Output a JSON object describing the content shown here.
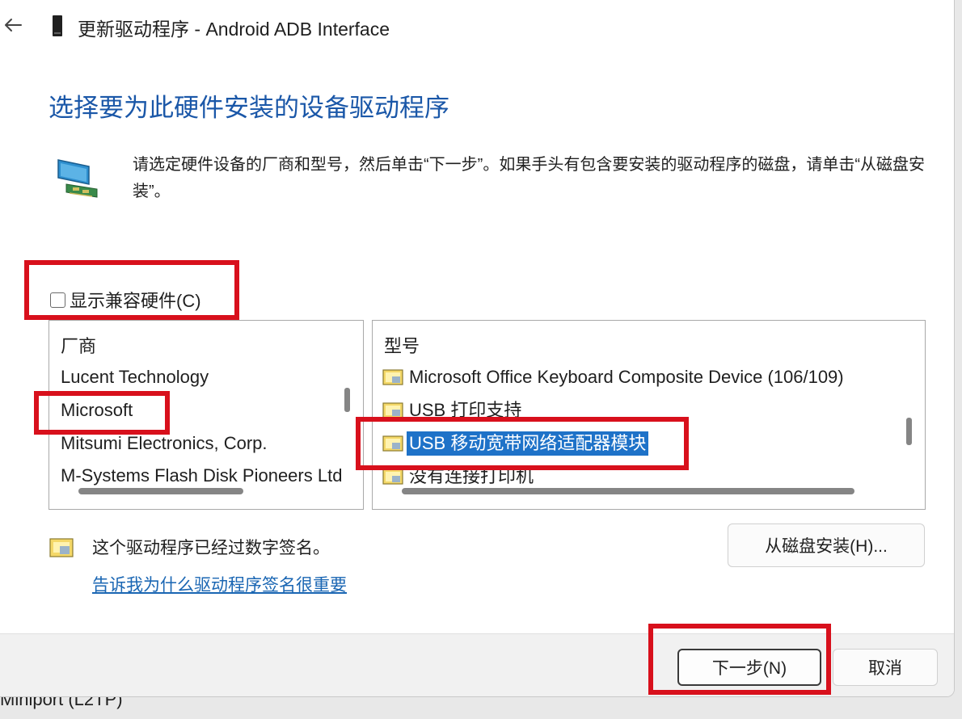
{
  "window": {
    "title": "更新驱动程序 - Android ADB Interface"
  },
  "page": {
    "heading": "选择要为此硬件安装的设备驱动程序",
    "instruction": "请选定硬件设备的厂商和型号，然后单击“下一步”。如果手头有包含要安装的驱动程序的磁盘，请单击“从磁盘安装”。"
  },
  "compatible_checkbox": {
    "label": "显示兼容硬件(C)",
    "checked": false
  },
  "manufacturer_list": {
    "header": "厂商",
    "items": [
      "Lucent Technology",
      "Microsoft",
      "Mitsumi Electronics, Corp.",
      "M-Systems Flash Disk Pioneers Ltd"
    ],
    "selected": "Microsoft"
  },
  "model_list": {
    "header": "型号",
    "items": [
      "Microsoft Office Keyboard Composite Device (106/109)",
      "USB 打印支持",
      "USB 移动宽带网络适配器模块",
      "没有连接打印机"
    ],
    "selected": "USB 移动宽带网络适配器模块"
  },
  "signature": {
    "text": "这个驱动程序已经过数字签名。",
    "link": "告诉我为什么驱动程序签名很重要"
  },
  "buttons": {
    "have_disk": "从磁盘安装(H)...",
    "next": "下一步(N)",
    "cancel": "取消"
  },
  "background": {
    "text": "Miniport (L2TP)"
  },
  "colors": {
    "heading": "#1a57a8",
    "selection": "#1e72c8",
    "link": "#1a66b3",
    "annotation": "#d8101c"
  }
}
